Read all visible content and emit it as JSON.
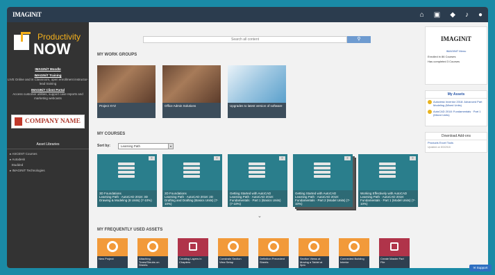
{
  "topbar": {
    "logo": "IMAGINiT",
    "icons": [
      "home-icon",
      "briefcase-icon",
      "graduation-cap-icon",
      "bell-icon",
      "user-icon"
    ]
  },
  "sidebar": {
    "brand_top": "Productivity",
    "brand_main": "NOW",
    "links": [
      {
        "title": "IMAGINiT Moodle",
        "desc": ""
      },
      {
        "title": "IMAGINiT Training",
        "desc": "LIVE Online and in Classroom, open enrollment instructor-lead training"
      },
      {
        "title": "IMAGINiT Client Portal",
        "desc": "Access customer utilities, support case reports and marketing webcasts"
      }
    ],
    "company_name": "COMPANY NAME",
    "asset_libraries": "Asset Libraries",
    "libraries": [
      "ASCENT Courses",
      "Autodesk",
      "Studded",
      "IMAGINiT Technologies"
    ]
  },
  "search": {
    "placeholder": "Search all content"
  },
  "sections": {
    "work_groups": "MY WORK GROUPS",
    "courses": "MY COURSES",
    "frequent": "MY FREQUENTLY USED ASSETS"
  },
  "work_groups": [
    {
      "label": "Project XYZ"
    },
    {
      "label": "Office Admin Solutions"
    },
    {
      "label": "Upgrades to latest version of software"
    }
  ],
  "sort": {
    "label": "Sort by:",
    "value": "Learning Path"
  },
  "courses": [
    {
      "title": "3D Foundations",
      "sub": "Learning Path · AutoCAD 2018: 3D Drawing & Modeling (8 Units)",
      "pct": "(7-10%)"
    },
    {
      "title": "2D Foundations",
      "sub": "Learning Path · AutoCAD 2018: 2D Drafting and Drafting (Basics Units)",
      "pct": "(7-10%)"
    },
    {
      "title": "Getting Started with AutoCAD",
      "sub": "Learning Path · AutoCAD 2018: Fundamentals · Part 1 (Basics Units)",
      "pct": "(7-10%)"
    },
    {
      "title": "Getting Started with AutoCAD",
      "sub": "Learning Path · AutoCAD 2018: Fundamentals · Part 2 (Model Units)",
      "pct": "(7-10%)"
    },
    {
      "title": "Working Effectively with AutoCAD",
      "sub": "Learning Path · AutoCAD 2018: Fundamentals · Part 1 (Model Units)",
      "pct": "(7-10%)"
    }
  ],
  "frequent": [
    {
      "label": "New Project",
      "kind": "orange"
    },
    {
      "label": "Attaching Trees/Shrubs on Sheets",
      "kind": "orange"
    },
    {
      "label": "Creating Layers in Chapters",
      "kind": "red"
    },
    {
      "label": "Constrain Section View Setup",
      "kind": "orange"
    },
    {
      "label": "Definition Precedent Sheets",
      "kind": "orange"
    },
    {
      "label": "Section Views at Moving a Tablet at 3pm",
      "kind": "orange"
    },
    {
      "label": "Connected Building Interior",
      "kind": "orange"
    },
    {
      "label": "Create Master Part File",
      "kind": "red"
    }
  ],
  "right": {
    "brand": "IMAGINiT",
    "menu_link": "IMAGINiT Menu",
    "enrolled": "Enrolled in 86 Courses",
    "completed": "Has completed 3 Courses",
    "my_assets_title": "My Assets",
    "assets": [
      "Autodesk Inventor 2018: Advanced Part Modeling (Mixed Units)",
      "AutoCAD 2018: Fundamentals · Part 1 (Mixed Units)"
    ],
    "download_title": "Download Add-ons",
    "download_item": "Products Excel Tools",
    "download_date": "Updated on 8/3/2018"
  },
  "support": "Support",
  "colors": {
    "brand_teal": "#1a8aa6",
    "topbar": "#2b3c4e",
    "accent_orange": "#f29a3a",
    "accent_red": "#b0344a"
  }
}
